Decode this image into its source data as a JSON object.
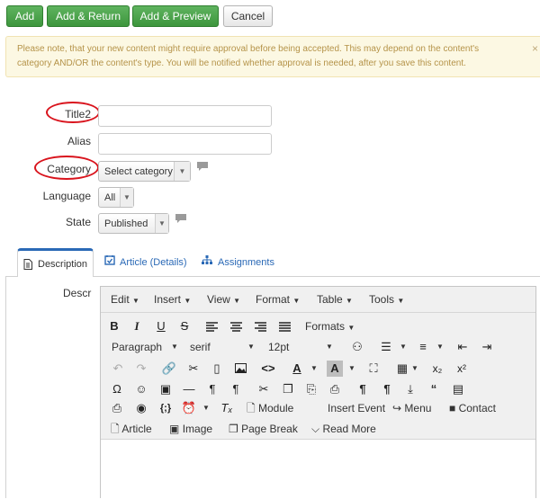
{
  "toolbar": {
    "add": "Add",
    "add_return": "Add & Return",
    "add_preview": "Add & Preview",
    "cancel": "Cancel"
  },
  "notice": {
    "line1": "Please note, that your new content might require approval before being accepted. This may depend on the content's",
    "line2": "category AND/OR the content's type. You will be notified whether approval is needed, after you save this content.",
    "close": "×"
  },
  "form": {
    "title_label": "Title2",
    "title_value": "",
    "alias_label": "Alias",
    "alias_value": "",
    "category_label": "Category",
    "category_value": "Select category",
    "language_label": "Language",
    "language_value": "All",
    "state_label": "State",
    "state_value": "Published"
  },
  "tabs": [
    "Description",
    "Article (Details)",
    "Assignments"
  ],
  "description_label": "Descr",
  "editor": {
    "menus": [
      "Edit",
      "Insert",
      "View",
      "Format",
      "Table",
      "Tools"
    ],
    "formats_label": "Formats",
    "block_format": "Paragraph",
    "font_family": "serif",
    "font_size": "12pt",
    "buttons": {
      "module": "Module",
      "insert_event": "Insert Event",
      "menu": "Menu",
      "contact": "Contact",
      "article": "Article",
      "image": "Image",
      "page_break": "Page Break",
      "read_more": "Read More"
    }
  },
  "colors": {
    "green": "#46a046",
    "notice_bg": "#fcf8e3",
    "notice_text": "#b59349",
    "link_blue": "#2a69b6",
    "annotation_red": "#d9141d"
  }
}
